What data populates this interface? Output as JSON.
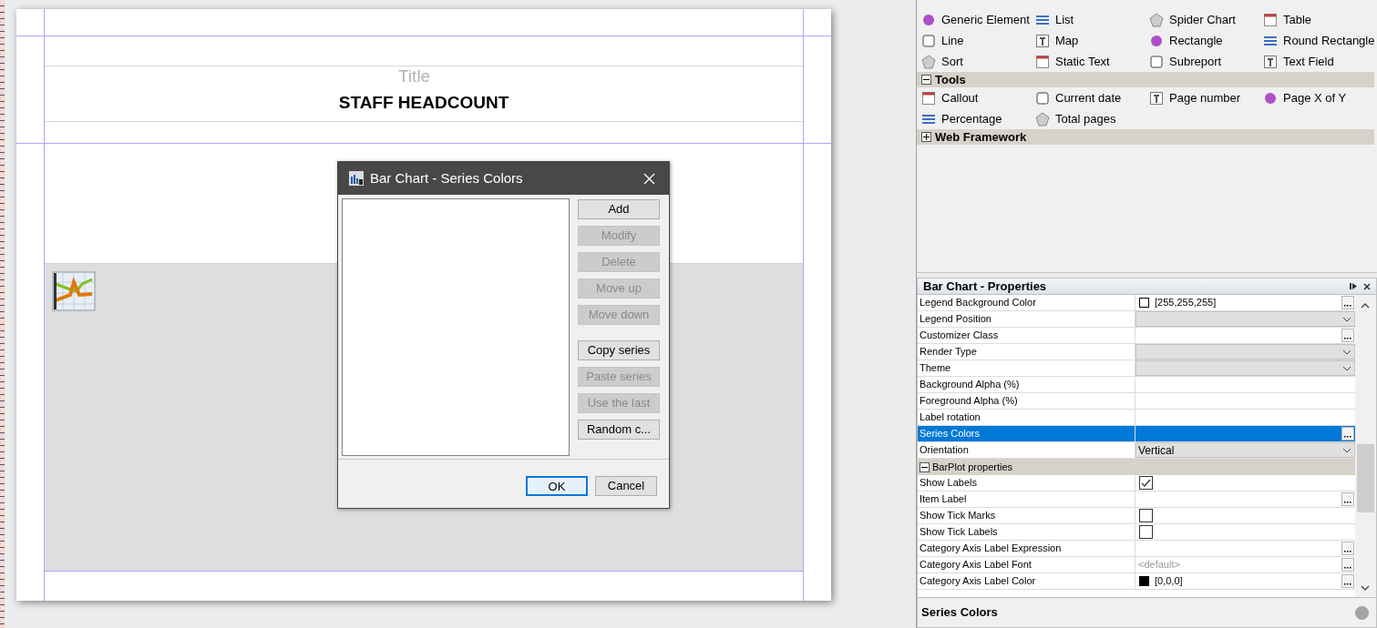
{
  "canvas": {
    "band_label": "Title",
    "title": "STAFF HEADCOUNT"
  },
  "dialog": {
    "title": "Bar Chart - Series Colors",
    "edit_buttons": [
      {
        "label": "Add",
        "disabled": false
      },
      {
        "label": "Modify",
        "disabled": true
      },
      {
        "label": "Delete",
        "disabled": true
      },
      {
        "label": "Move up",
        "disabled": true
      },
      {
        "label": "Move down",
        "disabled": true
      }
    ],
    "series_buttons": [
      {
        "label": "Copy series",
        "disabled": false
      },
      {
        "label": "Paste series",
        "disabled": true
      },
      {
        "label": "Use the last",
        "disabled": true
      },
      {
        "label": "Random c...",
        "disabled": false
      }
    ],
    "footer_buttons": [
      {
        "label": "OK",
        "default": true
      },
      {
        "label": "Cancel",
        "default": false
      }
    ]
  },
  "palette": {
    "items": [
      "Generic Element",
      "List",
      "Spider Chart",
      "Table",
      "Line",
      "Map",
      "Rectangle",
      "Round Rectangle",
      "Sort",
      "Static Text",
      "Subreport",
      "Text Field"
    ],
    "sections": [
      {
        "title": "Tools",
        "expanded": true,
        "items": [
          "Callout",
          "Current date",
          "Page number",
          "Page X of Y",
          "Percentage",
          "Total pages"
        ]
      },
      {
        "title": "Web Framework",
        "expanded": false
      }
    ]
  },
  "properties": {
    "title": "Bar Chart - Properties",
    "rows": [
      {
        "name": "Legend Background Color",
        "kind": "color",
        "value": "[255,255,255]",
        "color": "#ffffff",
        "selected": false
      },
      {
        "name": "Legend Position",
        "kind": "combo",
        "selected": false
      },
      {
        "name": "Customizer Class",
        "kind": "button",
        "selected": false
      },
      {
        "name": "Render Type",
        "kind": "combo",
        "selected": false
      },
      {
        "name": "Theme",
        "kind": "combo",
        "selected": false
      },
      {
        "name": "Background Alpha (%)",
        "kind": "text",
        "selected": false
      },
      {
        "name": "Foreground Alpha (%)",
        "kind": "text",
        "selected": false
      },
      {
        "name": "Label rotation",
        "kind": "text",
        "selected": false
      },
      {
        "name": "Series Colors",
        "kind": "button",
        "selected": true
      },
      {
        "name": "Orientation",
        "kind": "combo",
        "value": "Vertical",
        "selected": false
      },
      {
        "name": "BarPlot properties",
        "kind": "section",
        "expanded": true
      },
      {
        "name": "Show Labels",
        "kind": "checkbox",
        "checked": true,
        "selected": false
      },
      {
        "name": "Item Label",
        "kind": "button",
        "selected": false
      },
      {
        "name": "Show Tick Marks",
        "kind": "checkbox",
        "checked": false,
        "selected": false
      },
      {
        "name": "Show Tick Labels",
        "kind": "checkbox",
        "checked": false,
        "selected": false
      },
      {
        "name": "Category Axis Label Expression",
        "kind": "button",
        "selected": false
      },
      {
        "name": "Category Axis Label Font",
        "kind": "button",
        "placeholder": "<default>",
        "selected": false
      },
      {
        "name": "Category Axis Label Color",
        "kind": "color",
        "value": "[0,0,0]",
        "color": "#000000",
        "selected": false
      }
    ],
    "description": "Series Colors"
  }
}
